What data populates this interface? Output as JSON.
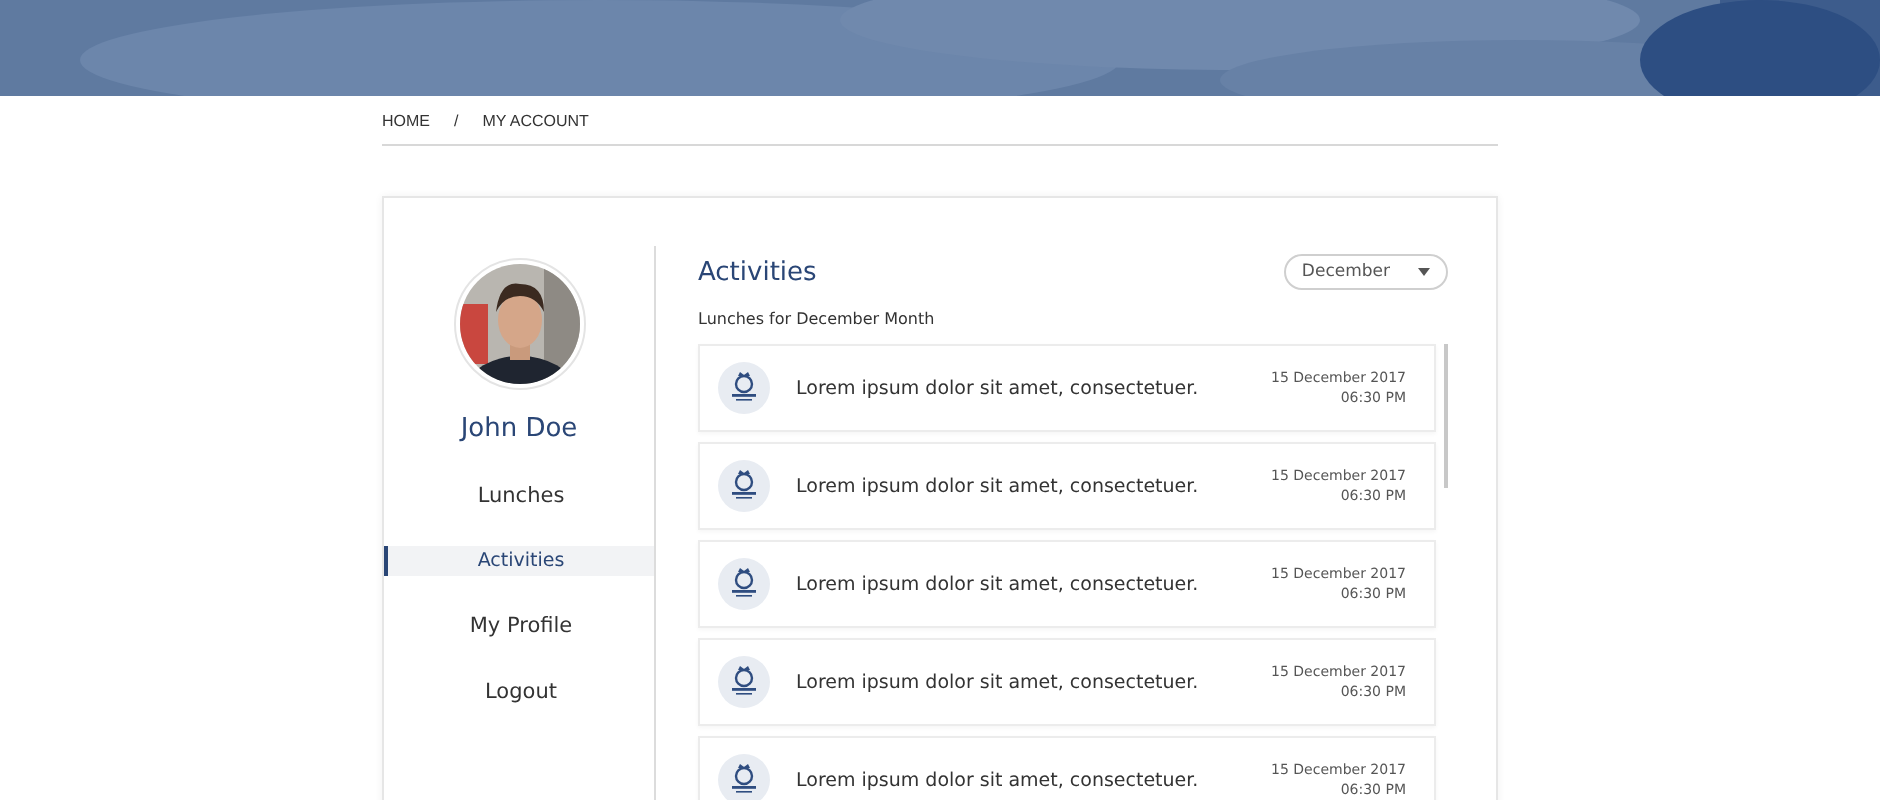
{
  "breadcrumb": [
    "HOME",
    "/",
    "MY ACCOUNT"
  ],
  "profile": {
    "name": "John Doe"
  },
  "menu": [
    {
      "label": "Lunches",
      "selected": false
    },
    {
      "label": "Activities",
      "selected": true
    },
    {
      "label": "My Profile",
      "selected": false
    },
    {
      "label": "Logout",
      "selected": false
    }
  ],
  "activities": {
    "title": "Activities",
    "subtitle": "Lunches for December Month",
    "month_dropdown": {
      "value": "December"
    },
    "rows": [
      {
        "text": "Lorem ipsum dolor sit amet, consectetuer.",
        "date": "15 December 2017",
        "time": "06:30 PM"
      },
      {
        "text": "Lorem ipsum dolor sit amet, consectetuer.",
        "date": "15 December 2017",
        "time": "06:30 PM"
      },
      {
        "text": "Lorem ipsum dolor sit amet, consectetuer.",
        "date": "15 December 2017",
        "time": "06:30 PM"
      },
      {
        "text": "Lorem ipsum dolor sit amet, consectetuer.",
        "date": "15 December 2017",
        "time": "06:30 PM"
      },
      {
        "text": "Lorem ipsum dolor sit amet, consectetuer.",
        "date": "15 December 2017",
        "time": "06:30 PM"
      }
    ]
  }
}
